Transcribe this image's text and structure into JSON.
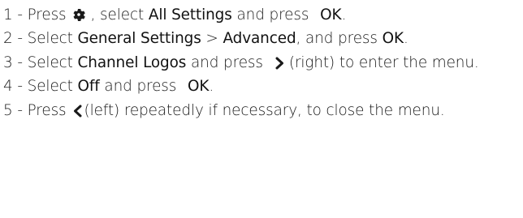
{
  "steps": [
    {
      "number": "1 -",
      "parts": {
        "a": "Press",
        "icon": "gear-icon",
        "b": ", select",
        "c": "All Settings",
        "d": "and press",
        "e": "OK",
        "f": "."
      }
    },
    {
      "number": "2 -",
      "parts": {
        "a": "Select",
        "b": "General Settings",
        "c": " > ",
        "d": "Advanced",
        "e": ", and press",
        "f": "OK",
        "g": "."
      }
    },
    {
      "number": "3 -",
      "parts": {
        "a": "Select",
        "b": "Channel Logos",
        "c": "and press",
        "icon": "chevron-right-icon",
        "d": "(right) to enter the menu."
      }
    },
    {
      "number": "4 -",
      "parts": {
        "a": "Select",
        "b": "Off",
        "c": "and press",
        "d": "OK",
        "e": "."
      }
    },
    {
      "number": "5 -",
      "parts": {
        "a": "Press",
        "icon": "chevron-left-icon",
        "b": "(left) repeatedly if necessary, to close the menu."
      }
    }
  ]
}
